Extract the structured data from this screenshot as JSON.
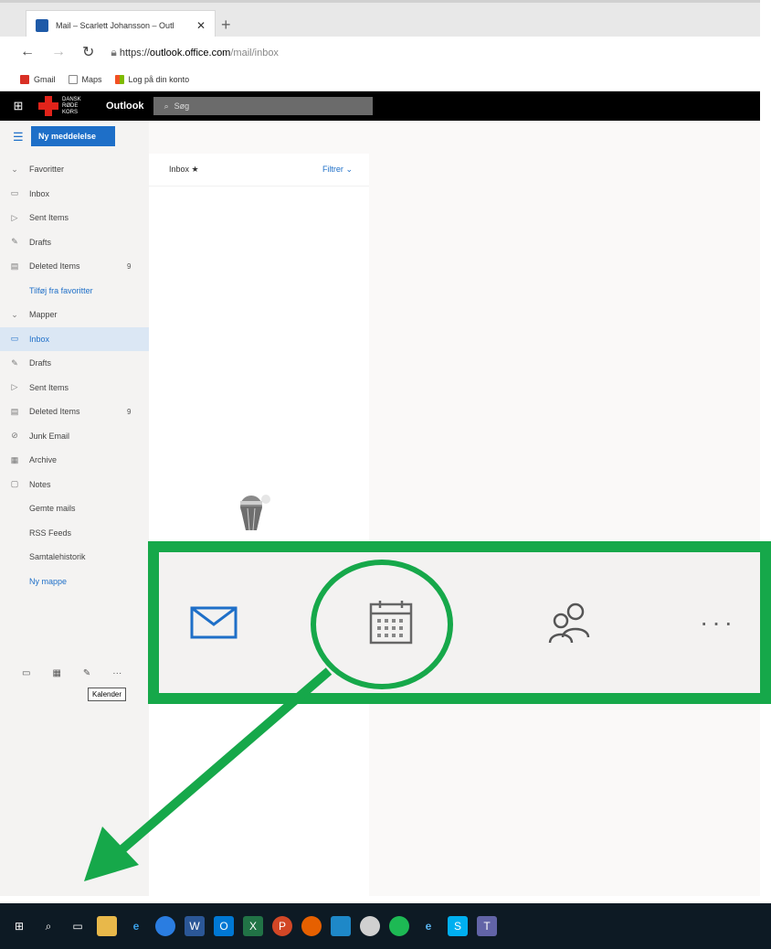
{
  "browser": {
    "tab_title": "Mail – Scarlett Johansson – Outl",
    "url_scheme": "https://",
    "url_host": "outlook.office.com",
    "url_path": "/mail/inbox",
    "favorites": [
      {
        "label": "Gmail",
        "color": "#d93025"
      },
      {
        "label": "Maps",
        "color": "#888888"
      },
      {
        "label": "Log på din konto",
        "color": "#e8a000"
      }
    ]
  },
  "header": {
    "org_text": "DANSK RØDE KORS",
    "app_name": "Outlook",
    "search_placeholder": "Søg"
  },
  "sidebar": {
    "new_message_label": "Ny meddelelse",
    "items": [
      {
        "icon": "chevron-down-icon",
        "label": "Favoritter",
        "count": ""
      },
      {
        "icon": "inbox-icon",
        "label": "Inbox",
        "count": ""
      },
      {
        "icon": "sent-icon",
        "label": "Sent Items",
        "count": ""
      },
      {
        "icon": "pencil-icon",
        "label": "Drafts",
        "count": ""
      },
      {
        "icon": "trash-icon",
        "label": "Deleted Items",
        "count": "9"
      },
      {
        "icon": "",
        "label": "Tilføj fra favoritter",
        "count": ""
      },
      {
        "icon": "chevron-down-icon",
        "label": "Mapper",
        "count": ""
      },
      {
        "icon": "inbox-icon",
        "label": "Inbox",
        "count": ""
      },
      {
        "icon": "pencil-icon",
        "label": "Drafts",
        "count": ""
      },
      {
        "icon": "sent-icon",
        "label": "Sent Items",
        "count": ""
      },
      {
        "icon": "trash-icon",
        "label": "Deleted Items",
        "count": "9"
      },
      {
        "icon": "junk-icon",
        "label": "Junk Email",
        "count": ""
      },
      {
        "icon": "archive-icon",
        "label": "Archive",
        "count": ""
      },
      {
        "icon": "notes-icon",
        "label": "Notes",
        "count": ""
      },
      {
        "icon": "",
        "label": "Gemte mails",
        "count": ""
      },
      {
        "icon": "",
        "label": "RSS Feeds",
        "count": ""
      },
      {
        "icon": "",
        "label": "Samtalehistorik",
        "count": ""
      },
      {
        "icon": "",
        "label": "Ny mappe",
        "count": ""
      }
    ],
    "tooltip": "Kalender"
  },
  "list": {
    "folder_title": "Inbox",
    "filter_label": "Filtrer"
  },
  "colors": {
    "accent": "#1e6fc8",
    "highlight_green": "#16a84a",
    "brand_red": "#e2231a"
  }
}
